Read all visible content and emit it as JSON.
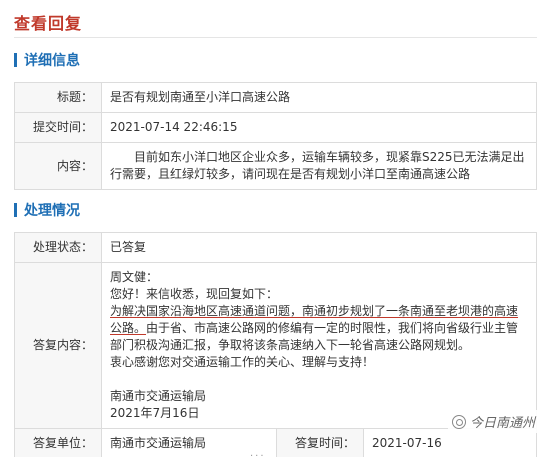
{
  "page": {
    "title": "查看回复"
  },
  "detail": {
    "heading": "详细信息",
    "rows": {
      "title_label": "标题：",
      "title_value": "是否有规划南通至小洋口高速公路",
      "time_label": "提交时间：",
      "time_value": "2021-07-14 22:46:15",
      "content_label": "内容：",
      "content_value": "目前如东小洋口地区企业众多，运输车辆较多，现紧靠S225已无法满足出行需要，且红绿灯较多，请问现在是否有规划小洋口至南通高速公路"
    }
  },
  "handling": {
    "heading": "处理情况",
    "status_label": "处理状态：",
    "status_value": "已答复",
    "reply_label": "答复内容：",
    "reply": {
      "greeting": "周文健：",
      "intro": "您好！来信收悉，现回复如下：",
      "highlighted": "为解决国家沿海地区高速通道问题，南通初步规划了一条南通至老坝港的高速公路。",
      "body": "由于省、市高速公路网的修编有一定的时限性，我们将向省级行业主管部门积极沟通汇报，争取将该条高速纳入下一轮省高速公路网规划。",
      "thanks": "衷心感谢您对交通运输工作的关心、理解与支持！",
      "signature": "南通市交通运输局",
      "date": "2021年7月16日"
    },
    "unit_label": "答复单位：",
    "unit_value": "南通市交通运输局",
    "reply_time_label": "答复时间：",
    "reply_time_value": "2021-07-16"
  },
  "watermark": {
    "icon": "wechat-channel-icon",
    "text": "今日南通州"
  },
  "footer": {
    "text": "..."
  }
}
